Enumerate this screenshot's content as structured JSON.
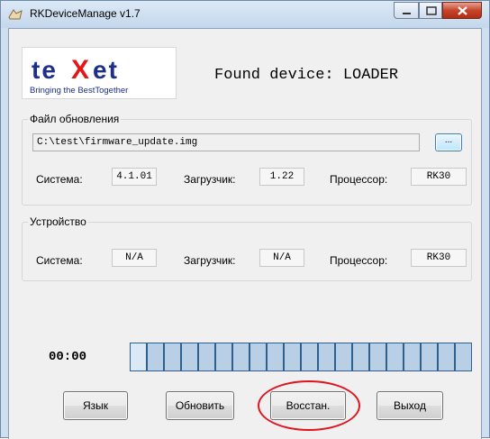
{
  "window": {
    "title": "RKDeviceManage v1.7"
  },
  "logo": {
    "brand": "teXet",
    "tagline": "Bringing the BestTogether"
  },
  "status": {
    "found": "Found device: LOADER"
  },
  "update_group": {
    "label": "Файл обновления",
    "path": "C:\\test\\firmware_update.img",
    "browse_label": "...",
    "system_label": "Система:",
    "system_value": "4.1.01",
    "loader_label": "Загрузчик:",
    "loader_value": "1.22",
    "cpu_label": "Процессор:",
    "cpu_value": "RK30"
  },
  "device_group": {
    "label": "Устройство",
    "system_label": "Система:",
    "system_value": "N/A",
    "loader_label": "Загрузчик:",
    "loader_value": "N/A",
    "cpu_label": "Процессор:",
    "cpu_value": "RK30"
  },
  "progress": {
    "timer": "00:00",
    "segments_total": 20,
    "segments_filled": 1
  },
  "buttons": {
    "language": "Язык",
    "update": "Обновить",
    "restore": "Восстан.",
    "exit": "Выход"
  },
  "colors": {
    "logo_blue": "#1c2f8c",
    "logo_red": "#e3161b",
    "annotation": "#e0141e"
  }
}
